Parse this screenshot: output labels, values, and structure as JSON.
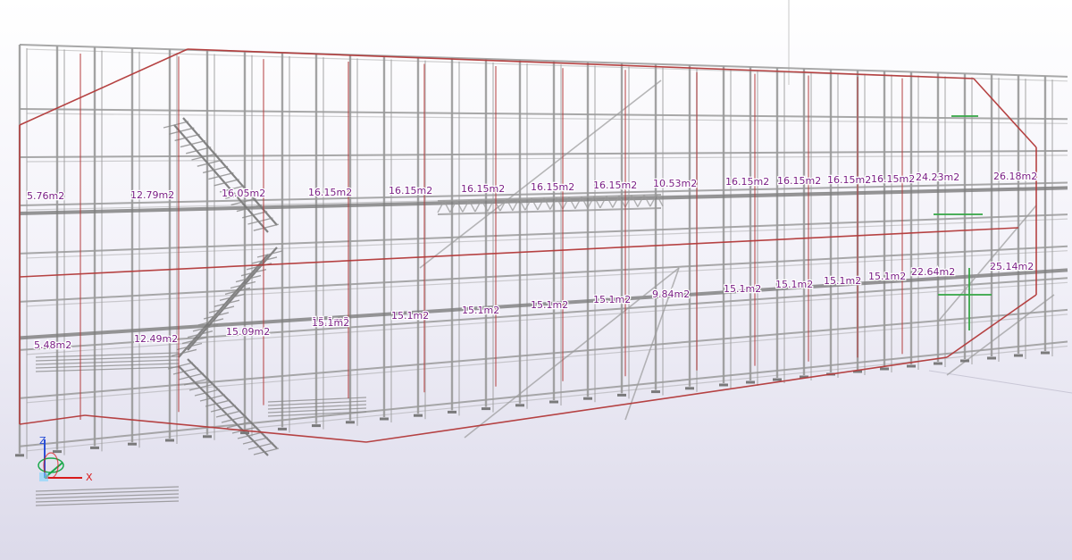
{
  "viewport": {
    "background_top": "#ffffff",
    "background_bottom": "#dcdaea",
    "scaffold_color": "#9a9a9a",
    "boundary_color": "#b33a3a",
    "label_color": "#7a1f86"
  },
  "axis_gizmo": {
    "x_label": "X",
    "z_label": "Z",
    "x_color": "#d81b1b",
    "y_color": "#1aa84a",
    "z_color": "#2a4fd6"
  },
  "area_labels": {
    "upper": [
      "5.76m2",
      "12.79m2",
      "16.05m2",
      "16.15m2",
      "16.15m2",
      "16.15m2",
      "16.15m2",
      "16.15m2",
      "10.53m2",
      "16.15m2",
      "16.15m2",
      "16.15m2",
      "16.15m2",
      "24.23m2",
      "26.18m2"
    ],
    "middle": [
      "15.1m2",
      "15.1m2",
      "15.1m2",
      "15.1m2",
      "15.1m2",
      "9.84m2",
      "15.1m2",
      "15.1m2",
      "15.1m2",
      "15.1m2",
      "22.64m2",
      "25.14m2"
    ],
    "lower": [
      "5.48m2",
      "12.49m2",
      "15.09m2",
      "15.1m2"
    ]
  }
}
